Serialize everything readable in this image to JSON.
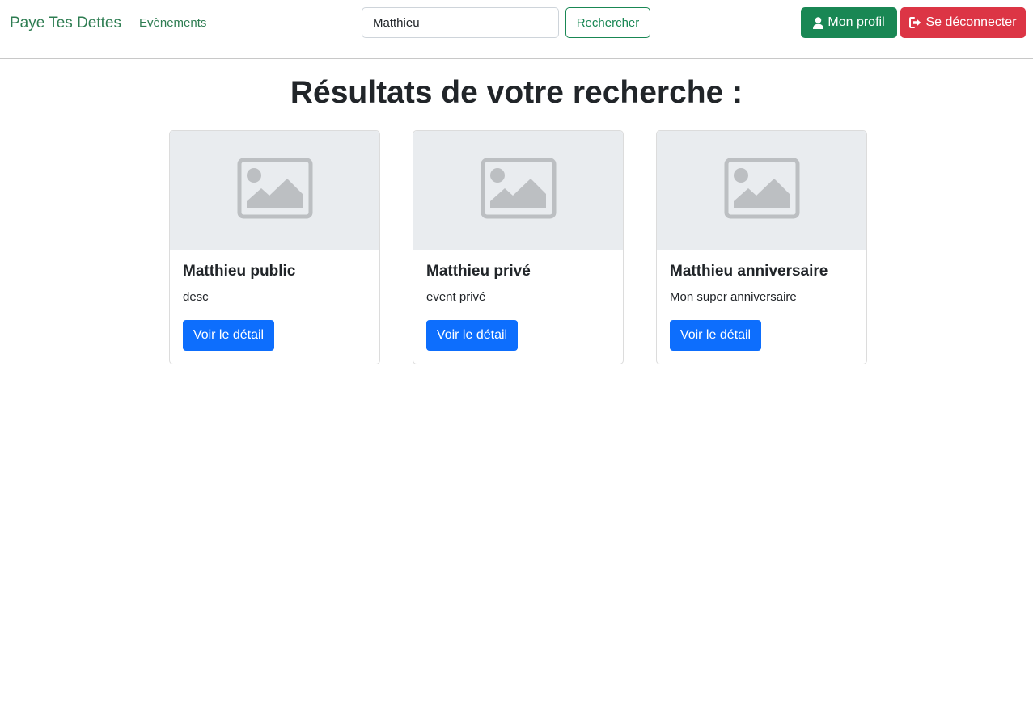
{
  "navbar": {
    "brand": "Paye Tes Dettes",
    "events_link": "Evènements",
    "search": {
      "value": "Matthieu",
      "button_label": "Rechercher"
    },
    "profile_button": {
      "label": "Mon profil",
      "icon": "user-icon"
    },
    "logout_button": {
      "label": "Se déconnecter",
      "icon": "sign-out-icon"
    }
  },
  "main": {
    "title": "Résultats de votre recherche :",
    "cards": [
      {
        "title": "Matthieu public",
        "description": "desc",
        "button_label": "Voir le détail",
        "image_icon": "image-placeholder-icon"
      },
      {
        "title": "Matthieu privé",
        "description": "event privé",
        "button_label": "Voir le détail",
        "image_icon": "image-placeholder-icon"
      },
      {
        "title": "Matthieu anniversaire",
        "description": "Mon super anniversaire",
        "button_label": "Voir le détail",
        "image_icon": "image-placeholder-icon"
      }
    ]
  },
  "colors": {
    "success": "#198754",
    "danger": "#dc3545",
    "primary": "#0d6efd",
    "placeholder_bg": "#e9ecef",
    "placeholder_icon": "#bcbfc2"
  }
}
